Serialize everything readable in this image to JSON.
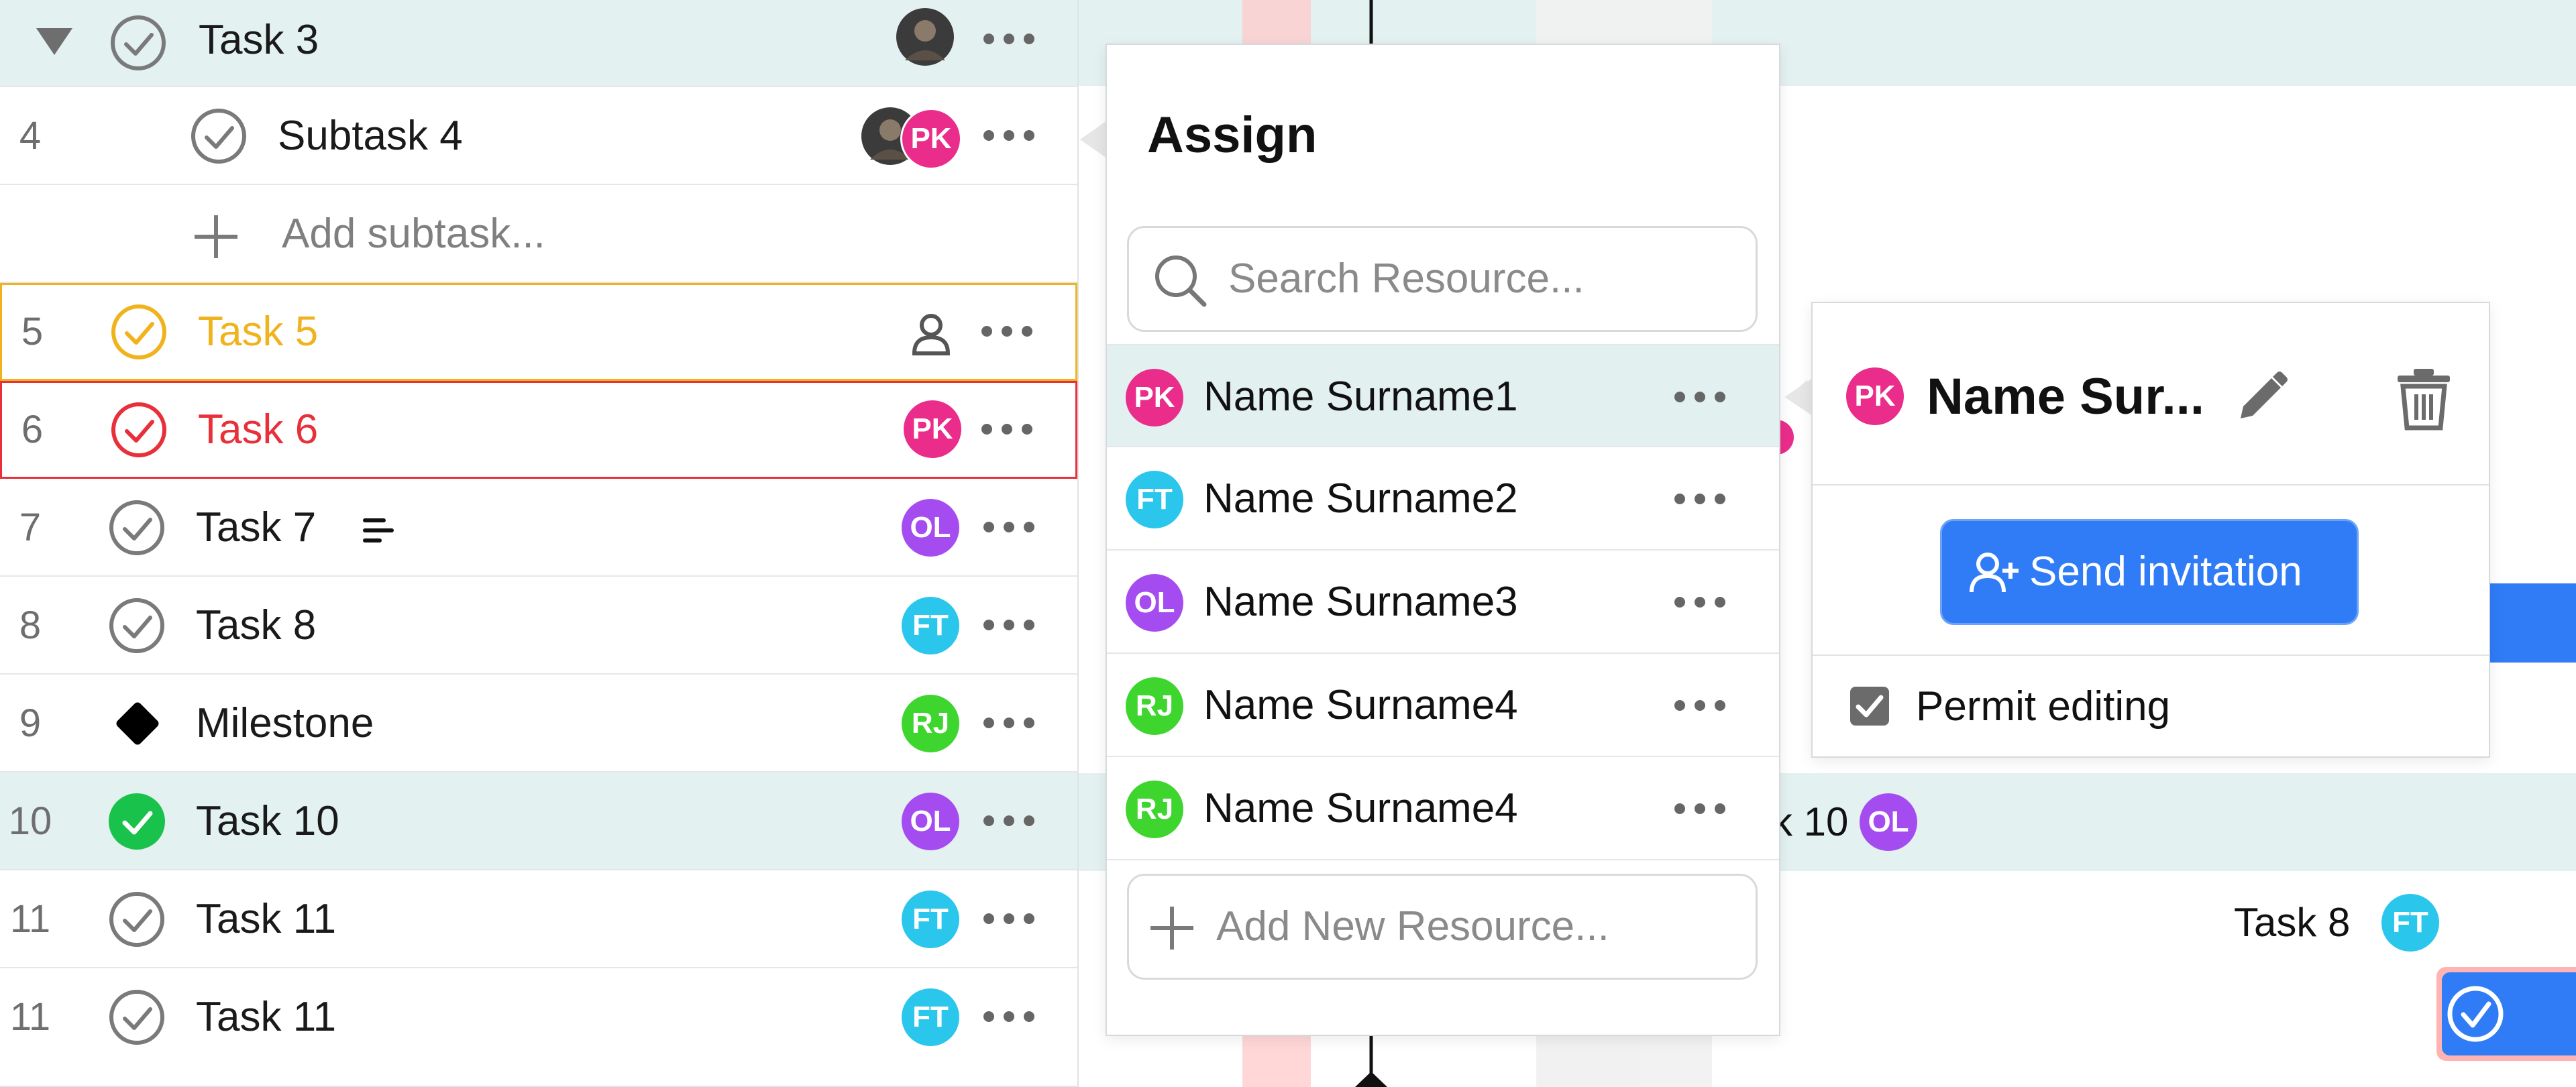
{
  "colors": {
    "highlight_row": "#e4f1f1",
    "task5": "#f0b31e",
    "task6": "#e8303a",
    "done_green": "#19c24a",
    "primary_blue": "#2f7cf6",
    "avatar_pk": "#ea2d8b",
    "avatar_ft": "#2bc6ec",
    "avatar_ol": "#a54cf0",
    "avatar_rj": "#3ed62e",
    "today_band": "#ffc9c9"
  },
  "task_list": {
    "rows": [
      {
        "num": "",
        "title": "Task 3",
        "assignee": "photo",
        "expanded": true
      },
      {
        "num": "4",
        "title": "Subtask 4",
        "assignee": "photo+PK"
      },
      {
        "num": "",
        "title": "Add subtask...",
        "type": "add"
      },
      {
        "num": "5",
        "title": "Task 5",
        "assignee": "person-icon",
        "state": "yellow"
      },
      {
        "num": "6",
        "title": "Task 6",
        "assignee": "PK",
        "state": "red"
      },
      {
        "num": "7",
        "title": "Task 7",
        "assignee": "OL",
        "note_icon": "notes-icon"
      },
      {
        "num": "8",
        "title": "Task 8",
        "assignee": "FT"
      },
      {
        "num": "9",
        "title": "Milestone",
        "assignee": "RJ",
        "type": "milestone"
      },
      {
        "num": "10",
        "title": "Task 10",
        "assignee": "OL",
        "state": "done"
      },
      {
        "num": "11",
        "title": "Task 11",
        "assignee": "FT"
      },
      {
        "num": "11",
        "title": "Task 11",
        "assignee": "FT"
      }
    ]
  },
  "avatars": {
    "pk": "PK",
    "ft": "FT",
    "ol": "OL",
    "rj": "RJ"
  },
  "assign_popup": {
    "title": "Assign",
    "search_placeholder": "Search Resource...",
    "resources": [
      {
        "initials": "PK",
        "name": "Name Surname1",
        "selected": true
      },
      {
        "initials": "FT",
        "name": "Name Surname2"
      },
      {
        "initials": "OL",
        "name": "Name Surname3"
      },
      {
        "initials": "RJ",
        "name": "Name Surname4"
      },
      {
        "initials": "RJ",
        "name": "Name Surname4"
      }
    ],
    "add_placeholder": "Add New Resource..."
  },
  "detail_popup": {
    "initials": "PK",
    "name": "Name Sur...",
    "invite_label": "Send invitation",
    "permit_label": "Permit editing",
    "permit_checked": true
  },
  "gantt": {
    "task10_label": "k 10",
    "task10_avatar": "OL",
    "task8_label": "Task 8",
    "task8_avatar": "FT"
  }
}
